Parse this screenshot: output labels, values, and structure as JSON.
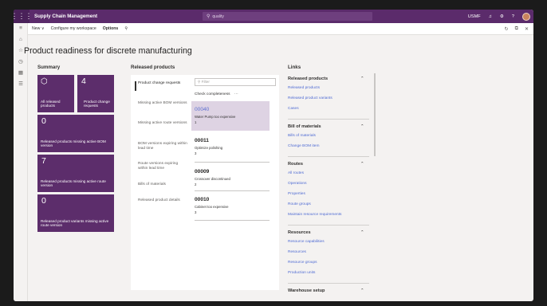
{
  "topbar": {
    "waffle_icon": "waffle-icon",
    "app_title": "Supply Chain Management",
    "search_placeholder": "quality",
    "company": "USMF",
    "bell_icon": "bell-icon",
    "settings_icon": "gear-icon",
    "help_icon": "help-icon"
  },
  "actionbar": {
    "new_label": "New ∨",
    "configure_label": "Configure my workspace",
    "options_label": "Options"
  },
  "page": {
    "title": "Product readiness for discrete manufacturing"
  },
  "summary": {
    "title": "Summary",
    "tiles": [
      {
        "count": "",
        "label": "All released products"
      },
      {
        "count": "4",
        "label": "Product change requests"
      },
      {
        "count": "0",
        "label": "Released products missing active BOM version"
      },
      {
        "count": "7",
        "label": "Released products missing active route version"
      },
      {
        "count": "0",
        "label": "Released product variants missing active route version"
      }
    ]
  },
  "released": {
    "title": "Released products",
    "nav": [
      "Product change requests",
      "Missing active BOM versions",
      "Missing active route versions",
      "BOM versions expiring within lead time",
      "Route versions expiring within lead time",
      "Bills of materials",
      "Released product details"
    ],
    "filter_placeholder": "Filter",
    "check_completeness": "Check completeness",
    "more": "···",
    "items": [
      {
        "code": "00040",
        "desc": "Water Pump too expensive",
        "num": "1"
      },
      {
        "code": "00011",
        "desc": "Optimize polishing",
        "num": "3"
      },
      {
        "code": "00009",
        "desc": "Crossover discontinued",
        "num": "2"
      },
      {
        "code": "00010",
        "desc": "Cabinet too expensive",
        "num": "3"
      }
    ]
  },
  "links": {
    "title": "Links",
    "groups": [
      {
        "title": "Released products",
        "items": [
          "Released products",
          "Released product variants",
          "Cases"
        ]
      },
      {
        "title": "Bill of materials",
        "items": [
          "Bills of materials",
          "Change BOM item"
        ]
      },
      {
        "title": "Routes",
        "items": [
          "All routes",
          "Operations",
          "Properties",
          "Route groups",
          "Maintain resource requirements"
        ]
      },
      {
        "title": "Resources",
        "items": [
          "Resource capabilities",
          "Resources",
          "Resource groups",
          "Production units"
        ]
      },
      {
        "title": "Warehouse setup",
        "items": []
      }
    ]
  }
}
